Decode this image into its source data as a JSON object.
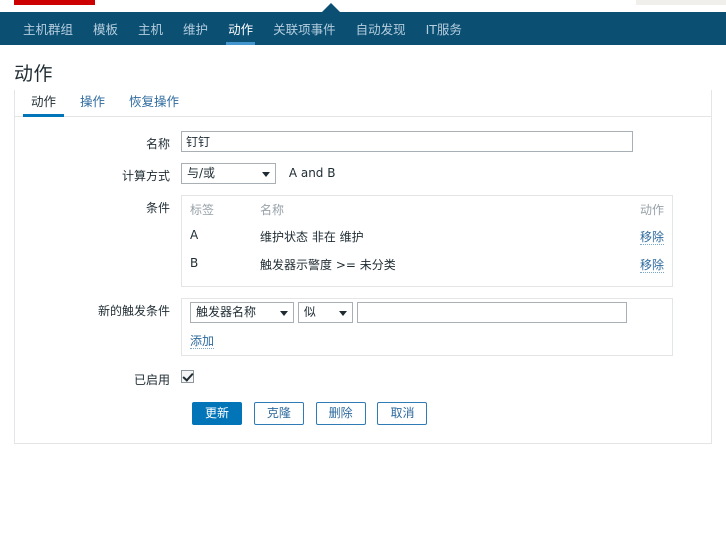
{
  "nav": {
    "items": [
      {
        "label": "主机群组",
        "active": false
      },
      {
        "label": "模板",
        "active": false
      },
      {
        "label": "主机",
        "active": false
      },
      {
        "label": "维护",
        "active": false
      },
      {
        "label": "动作",
        "active": true
      },
      {
        "label": "关联项事件",
        "active": false
      },
      {
        "label": "自动发现",
        "active": false
      },
      {
        "label": "IT服务",
        "active": false
      }
    ]
  },
  "page": {
    "title": "动作"
  },
  "tabs": [
    {
      "label": "动作",
      "active": true
    },
    {
      "label": "操作",
      "active": false
    },
    {
      "label": "恢复操作",
      "active": false
    }
  ],
  "form": {
    "name": {
      "label": "名称",
      "value": "钉钉",
      "placeholder": ""
    },
    "calc": {
      "label": "计算方式",
      "selected": "与/或",
      "formula": "A and B"
    },
    "conditions": {
      "label": "条件",
      "headers": {
        "label": "标签",
        "name": "名称",
        "action": "动作"
      },
      "rows": [
        {
          "label": "A",
          "name": "维护状态 非在 维护",
          "action": "移除"
        },
        {
          "label": "B",
          "name": "触发器示警度 >= 未分类",
          "action": "移除"
        }
      ]
    },
    "new_condition": {
      "label": "新的触发条件",
      "type_selected": "触发器名称",
      "operator_selected": "似",
      "value": "",
      "placeholder": "",
      "add_label": "添加"
    },
    "enabled": {
      "label": "已启用",
      "checked": true
    }
  },
  "buttons": [
    {
      "label": "更新",
      "primary": true
    },
    {
      "label": "克隆",
      "primary": false
    },
    {
      "label": "删除",
      "primary": false
    },
    {
      "label": "取消",
      "primary": false
    }
  ]
}
